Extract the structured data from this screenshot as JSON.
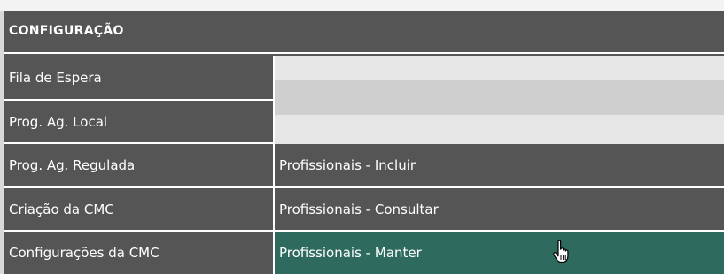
{
  "header": {
    "title": "CONFIGURAÇÃO"
  },
  "menu": {
    "items": [
      {
        "label": "Fila de Espera"
      },
      {
        "label": "Prog. Ag. Local"
      },
      {
        "label": "Prog. Ag. Regulada"
      },
      {
        "label": "Criação da CMC"
      },
      {
        "label": "Configurações da CMC"
      }
    ]
  },
  "submenu": {
    "items": [
      {
        "label": "Profissionais - Incluir"
      },
      {
        "label": "Profissionais - Consultar"
      },
      {
        "label": "Profissionais - Manter"
      }
    ]
  },
  "colors": {
    "panel": "#555555",
    "active": "#2e6a5e",
    "blank_light": "#e6e6e6",
    "blank_mid": "#cfcfcf"
  },
  "icons": {
    "cursor": "hand-pointer-icon"
  }
}
